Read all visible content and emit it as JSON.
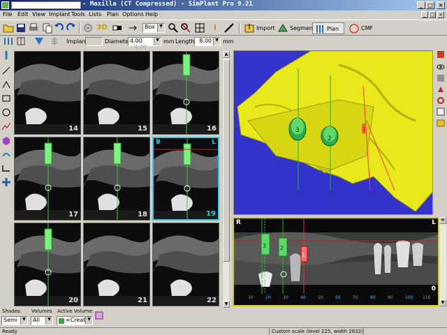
{
  "window": {
    "title": "- Maxilla (CT Compressed) - SimPlant Pro  9.21",
    "controls": [
      "_",
      "□",
      "×"
    ]
  },
  "menu": {
    "items": [
      "File",
      "Edit",
      "View",
      "Implant",
      "Tools",
      "Lists",
      "Plan",
      "Options",
      "Help"
    ],
    "mdi_controls": [
      "_",
      "□",
      "×"
    ]
  },
  "toolbar1": {
    "view_mode_label": "3D",
    "box_combo_value": "Box",
    "import_label": "Import",
    "segment_label": "Segment",
    "plan_label": "Plan",
    "cmf_label": "CMF"
  },
  "toolbar2": {
    "implant_label": "Implant",
    "diameter_label": "Diameter",
    "diameter_value": "4.00",
    "diameter_max": "4.00",
    "unit_mm_1": "mm",
    "length_label": "Length:",
    "length_value": "8.00",
    "unit_mm_2": "mm"
  },
  "cross_sections": {
    "numbers": [
      "14",
      "15",
      "16",
      "17",
      "18",
      "19",
      "20",
      "21",
      "22"
    ],
    "active_index": 5,
    "corner_left": "B",
    "corner_right": "L"
  },
  "implants_3d": {
    "labels": [
      "3",
      "2",
      "1"
    ],
    "colors": {
      "implant": "#66e06a",
      "bone": "#e8e81a",
      "background": "#3333cc",
      "planned": "#ff3333"
    }
  },
  "panoramic": {
    "corner_left": "R",
    "corner_right": "L",
    "zero_label": "0",
    "ticks": [
      "10",
      "20",
      "30",
      "40",
      "50",
      "60",
      "70",
      "80",
      "90",
      "100",
      "110"
    ],
    "implant_labels": [
      "3",
      "2",
      "1"
    ]
  },
  "bottom": {
    "shades_label": "Shades:",
    "shades_value": "Semi",
    "volumes_label": "Volumes",
    "volumes_value": "All",
    "active_volume_label": "Active Volume:",
    "active_volume_value": "<Create"
  },
  "status": {
    "left_text": "Ready",
    "scale_text": "Custom scale (level 225, width 2832)"
  }
}
